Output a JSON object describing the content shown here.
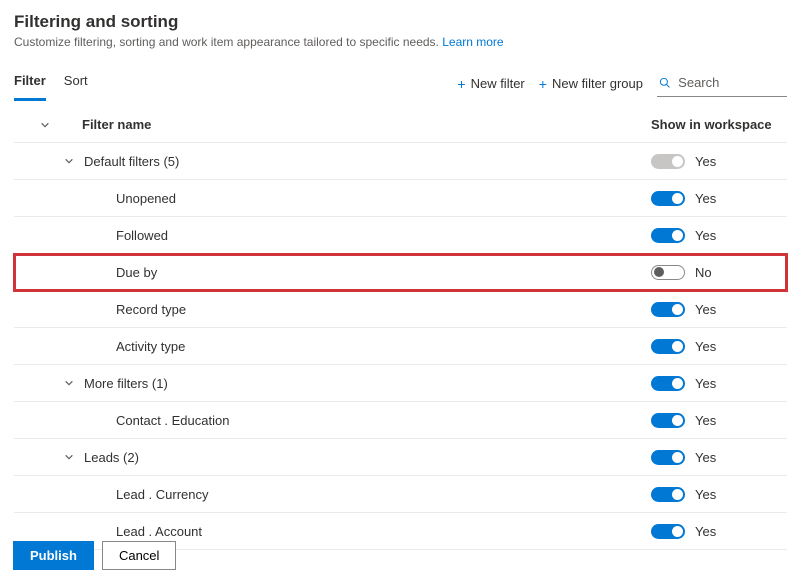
{
  "header": {
    "title": "Filtering and sorting",
    "subtitle_pre": "Customize filtering, sorting and work item appearance tailored to specific needs. ",
    "learn_more": "Learn more"
  },
  "tabs": {
    "filter": "Filter",
    "sort": "Sort"
  },
  "actions": {
    "new_filter": "New filter",
    "new_filter_group": "New filter group",
    "search_placeholder": "Search"
  },
  "columns": {
    "name": "Filter name",
    "show": "Show in workspace"
  },
  "labels": {
    "yes": "Yes",
    "no": "No"
  },
  "rows": [
    {
      "name": "Default filters (5)",
      "is_group": true,
      "toggle": "disabled",
      "label": "yes",
      "highlight": false
    },
    {
      "name": "Unopened",
      "is_group": false,
      "toggle": "on",
      "label": "yes",
      "highlight": false
    },
    {
      "name": "Followed",
      "is_group": false,
      "toggle": "on",
      "label": "yes",
      "highlight": false
    },
    {
      "name": "Due by",
      "is_group": false,
      "toggle": "off",
      "label": "no",
      "highlight": true
    },
    {
      "name": "Record type",
      "is_group": false,
      "toggle": "on",
      "label": "yes",
      "highlight": false
    },
    {
      "name": "Activity type",
      "is_group": false,
      "toggle": "on",
      "label": "yes",
      "highlight": false
    },
    {
      "name": "More filters (1)",
      "is_group": true,
      "toggle": "on",
      "label": "yes",
      "highlight": false
    },
    {
      "name": "Contact . Education",
      "is_group": false,
      "toggle": "on",
      "label": "yes",
      "highlight": false
    },
    {
      "name": "Leads (2)",
      "is_group": true,
      "toggle": "on",
      "label": "yes",
      "highlight": false
    },
    {
      "name": "Lead . Currency",
      "is_group": false,
      "toggle": "on",
      "label": "yes",
      "highlight": false
    },
    {
      "name": "Lead . Account",
      "is_group": false,
      "toggle": "on",
      "label": "yes",
      "highlight": false
    }
  ],
  "footer": {
    "publish": "Publish",
    "cancel": "Cancel"
  }
}
